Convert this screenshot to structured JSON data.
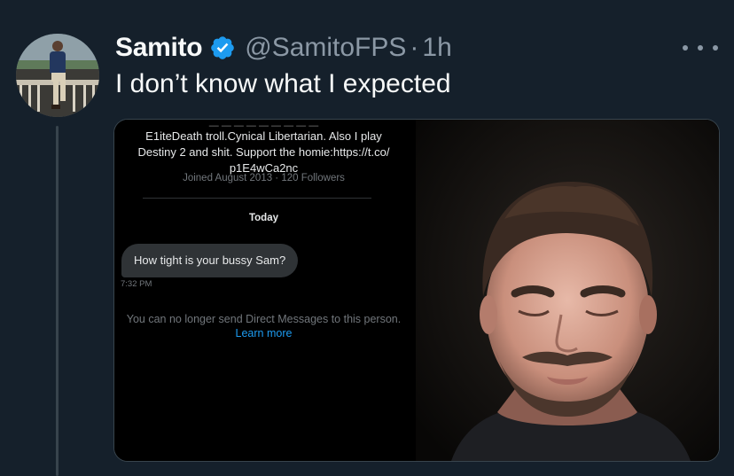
{
  "tweet": {
    "display_name": "Samito",
    "handle": "@SamitoFPS",
    "separator": "·",
    "time": "1h",
    "text": "I don’t know what I expected",
    "verified_icon": "verified-badge-icon",
    "more_icon": "more-options-icon"
  },
  "screenshot": {
    "bio_partial": "— — — — — — — — —",
    "bio_lines": [
      "E1iteDeath troll.Cynical Libertarian. Also I play",
      "Destiny 2 and shit. Support the homie:https://t.co/",
      "p1E4wCa2nc"
    ],
    "joined": "Joined August 2013 · 120 Followers",
    "day_label": "Today",
    "message": "How tight is your bussy Sam?",
    "message_time": "7:32 PM",
    "notice": "You can no longer send Direct Messages to this person.",
    "learn_more": "Learn more"
  },
  "colors": {
    "background": "#15202b",
    "accent": "#1d9bf0",
    "secondary_text": "#8b98a5"
  }
}
